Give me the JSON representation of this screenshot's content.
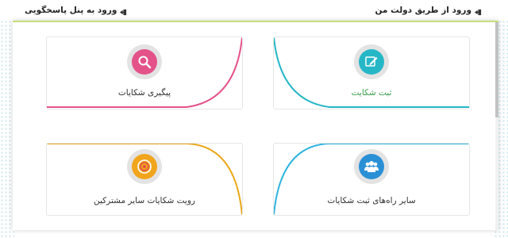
{
  "header": {
    "gov_login": "ورود از طریق دولت من",
    "panel_login": "ورود به پنل پاسخگویی"
  },
  "cards": {
    "register": {
      "label": "ثبت شکایت",
      "icon": "pencil-edit-icon",
      "accent": "#24b6c6",
      "label_color": "#3ea050"
    },
    "track": {
      "label": "پیگیری شکایات",
      "icon": "search-icon",
      "accent": "#e4528a",
      "label_color": "#333333"
    },
    "other": {
      "label": "سایر راه‌های ثبت شکایات",
      "icon": "users-icon",
      "accent": "#2fb4e0",
      "label_color": "#333333"
    },
    "view": {
      "label": "رویت شکایات سایر مشترکین",
      "icon": "target-icon",
      "accent": "#e9a81a",
      "label_color": "#333333"
    }
  },
  "colors": {
    "panel_top_border": "#c6de7a"
  }
}
